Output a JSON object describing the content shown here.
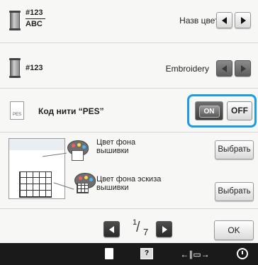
{
  "rows": {
    "thread_number_code": {
      "code_top": "#123",
      "code_bottom": "ABC",
      "label": "Назв цвета"
    },
    "thread_brand": {
      "code": "#123",
      "label": "Embroidery"
    },
    "pes_code": {
      "icon_text": "PES",
      "label": "Код нити “PES”",
      "on_label": "ON",
      "off_label": "OFF",
      "state": "on"
    },
    "bg_color": {
      "label_line1": "Цвет фона",
      "label_line2": "вышивки",
      "button": "Выбрать"
    },
    "thumb_bg_color": {
      "label_line1": "Цвет фона эскиза",
      "label_line2": "вышивки",
      "button": "Выбрать"
    }
  },
  "pager": {
    "current": "1",
    "total": "7",
    "ok": "OK"
  },
  "colors": {
    "accent": "#1e9be6",
    "bottom_bar": "#1a1a1a"
  },
  "bottom_bar": {
    "icons": [
      "document-icon",
      "help-icon",
      "presser-foot-icon",
      "clock-icon"
    ]
  }
}
